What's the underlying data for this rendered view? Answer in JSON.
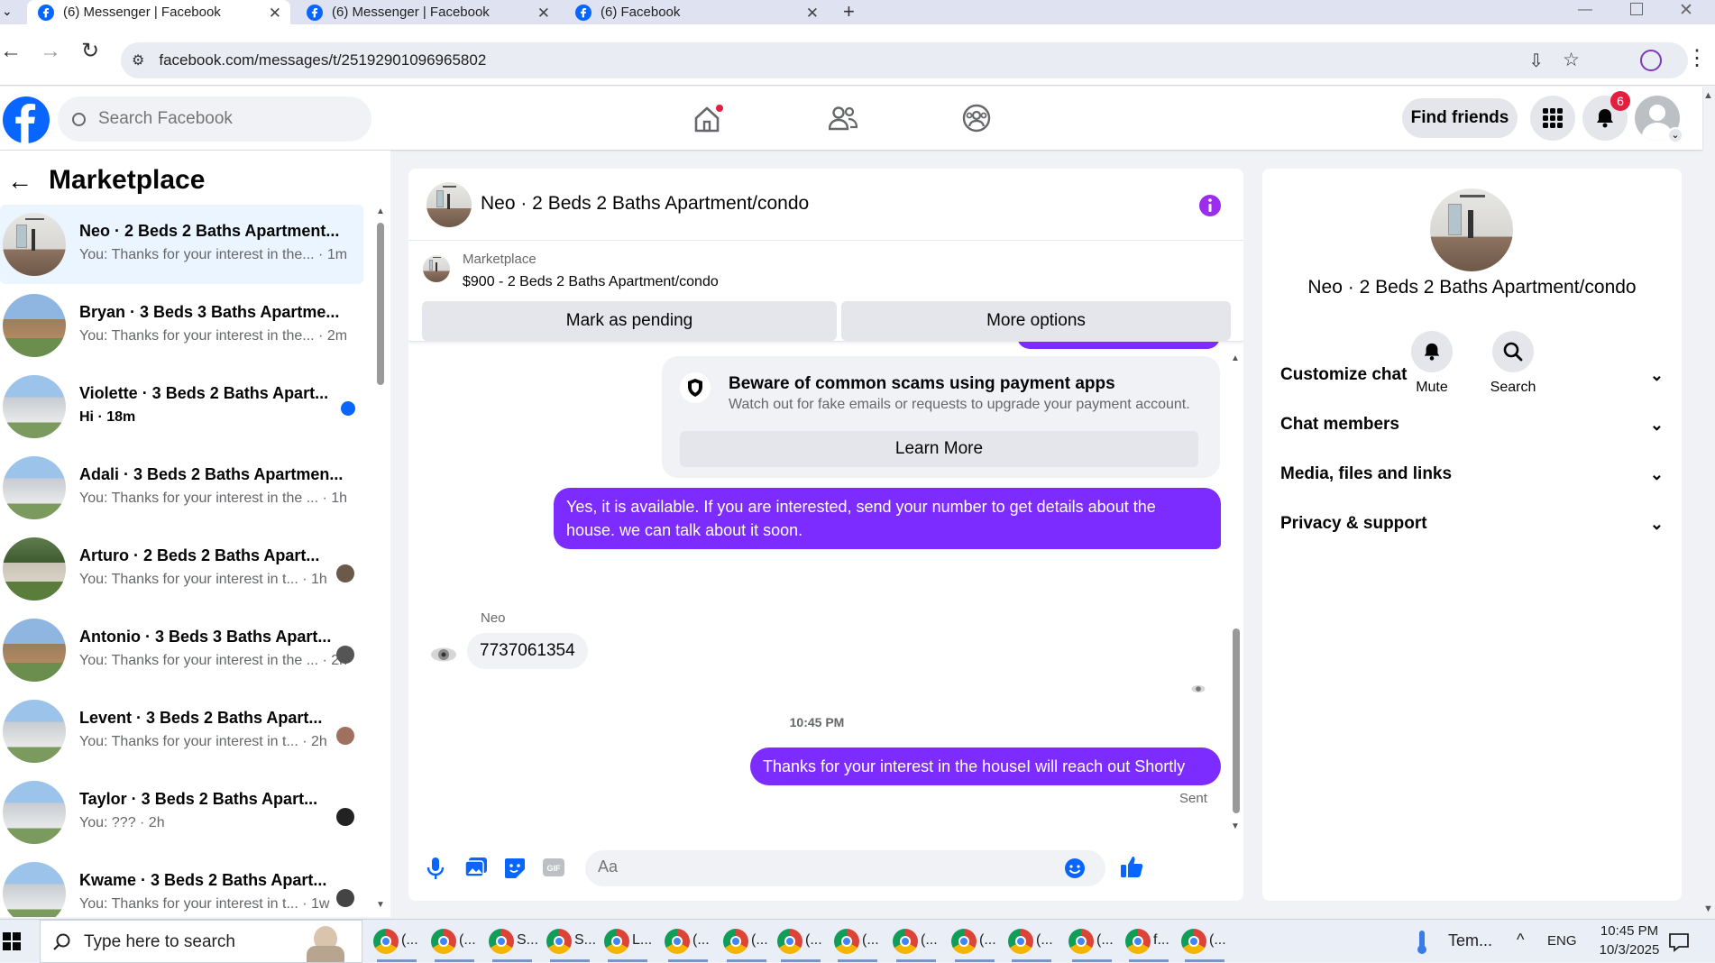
{
  "browser": {
    "tabs": [
      {
        "title": "(6) Messenger | Facebook"
      },
      {
        "title": "(6) Messenger | Facebook"
      },
      {
        "title": "(6) Facebook"
      }
    ],
    "url": "facebook.com/messages/t/25192901096965802"
  },
  "facebook": {
    "search_placeholder": "Search Facebook",
    "find_friends": "Find friends",
    "notification_count": "6"
  },
  "sidebar": {
    "title": "Marketplace",
    "conversations": [
      {
        "name": "Neo · 2 Beds 2 Baths Apartment...",
        "preview": "You: Thanks for your interest in the... · 1m",
        "selected": true,
        "unread": false
      },
      {
        "name": "Bryan · 3 Beds 3 Baths Apartme...",
        "preview": "You: Thanks for your interest in the... · 2m",
        "selected": false,
        "unread": false
      },
      {
        "name": "Violette · 3 Beds 2 Baths Apart...",
        "preview": "Hi · 18m",
        "selected": false,
        "unread": true
      },
      {
        "name": "Adali · 3 Beds 2 Baths Apartmen...",
        "preview": "You: Thanks for your interest in the ... · 1h",
        "selected": false,
        "unread": false
      },
      {
        "name": "Arturo · 2 Beds 2 Baths Apart...",
        "preview": "You: Thanks for your interest in t... · 1h",
        "selected": false,
        "unread": false
      },
      {
        "name": "Antonio · 3 Beds 3 Baths Apart...",
        "preview": "You: Thanks for your interest in the ... · 2h",
        "selected": false,
        "unread": false
      },
      {
        "name": "Levent · 3 Beds 2 Baths Apart...",
        "preview": "You: Thanks for your interest in t... · 2h",
        "selected": false,
        "unread": false
      },
      {
        "name": "Taylor · 3 Beds 2 Baths Apart...",
        "preview": "You: ??? · 2h",
        "selected": false,
        "unread": false
      },
      {
        "name": "Kwame · 3 Beds 2 Baths Apart...",
        "preview": "You: Thanks for your interest in t... · 1w",
        "selected": false,
        "unread": false
      }
    ]
  },
  "chat": {
    "title": "Neo · 2 Beds 2 Baths Apartment/condo",
    "listing_source": "Marketplace",
    "listing_title": "$900 - 2 Beds 2 Baths Apartment/condo",
    "mark_pending": "Mark as pending",
    "more_options": "More options",
    "scam_title": "Beware of common scams using payment apps",
    "scam_body": "Watch out for fake emails or requests to upgrade your payment account.",
    "learn_more": "Learn More",
    "msg_me_1": "Yes, it is available. If you are interested, send your number to get details about the house. we can talk about it soon.",
    "sender_name": "Neo",
    "msg_them": "7737061354",
    "timestamp": "10:45 PM",
    "msg_me_2": "Thanks for your interest in the houseI will reach out Shortly",
    "sent_status": "Sent",
    "composer_placeholder": "Aa"
  },
  "info_panel": {
    "title": "Neo · 2 Beds 2 Baths Apartment/condo",
    "mute": "Mute",
    "search": "Search",
    "sections": [
      "Customize chat",
      "Chat members",
      "Media, files and links",
      "Privacy & support"
    ]
  },
  "taskbar": {
    "search_placeholder": "Type here to search",
    "apps": [
      "(...",
      "(...",
      "S...",
      "S...",
      "L...",
      "(...",
      "(...",
      "(...",
      "(...",
      "(...",
      "(...",
      "(...",
      "(...",
      "f...",
      "(..."
    ],
    "weather": "Tem...",
    "lang": "ENG",
    "time": "10:45 PM",
    "date": "10/3/2025"
  },
  "colors": {
    "fb_blue": "#0866ff",
    "bubble_purple": "#7d2cff",
    "badge_red": "#e41e3f"
  }
}
